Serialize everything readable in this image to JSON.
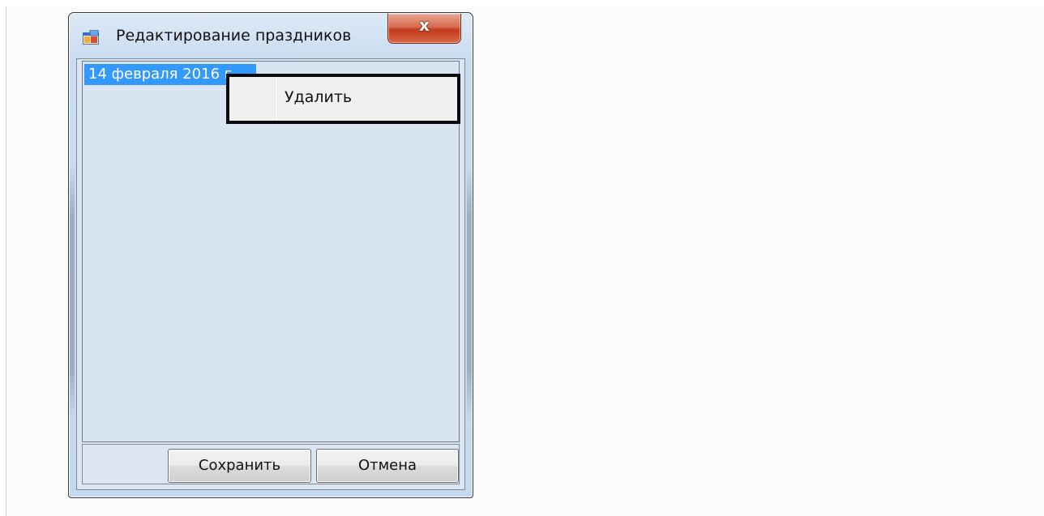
{
  "window": {
    "title": "Редактирование праздников",
    "icon": "application-icon",
    "close_label": "x"
  },
  "holidays_list": {
    "items": [
      {
        "label": "14 февраля 2016 г.",
        "selected": true
      }
    ]
  },
  "context_menu": {
    "items": [
      {
        "label": "Удалить"
      }
    ]
  },
  "buttons": {
    "save_label": "Сохранить",
    "cancel_label": "Отмена"
  },
  "colors": {
    "selection": "#3399ff",
    "close_button": "#c2391b",
    "window_frame": "#c4d8ee"
  }
}
